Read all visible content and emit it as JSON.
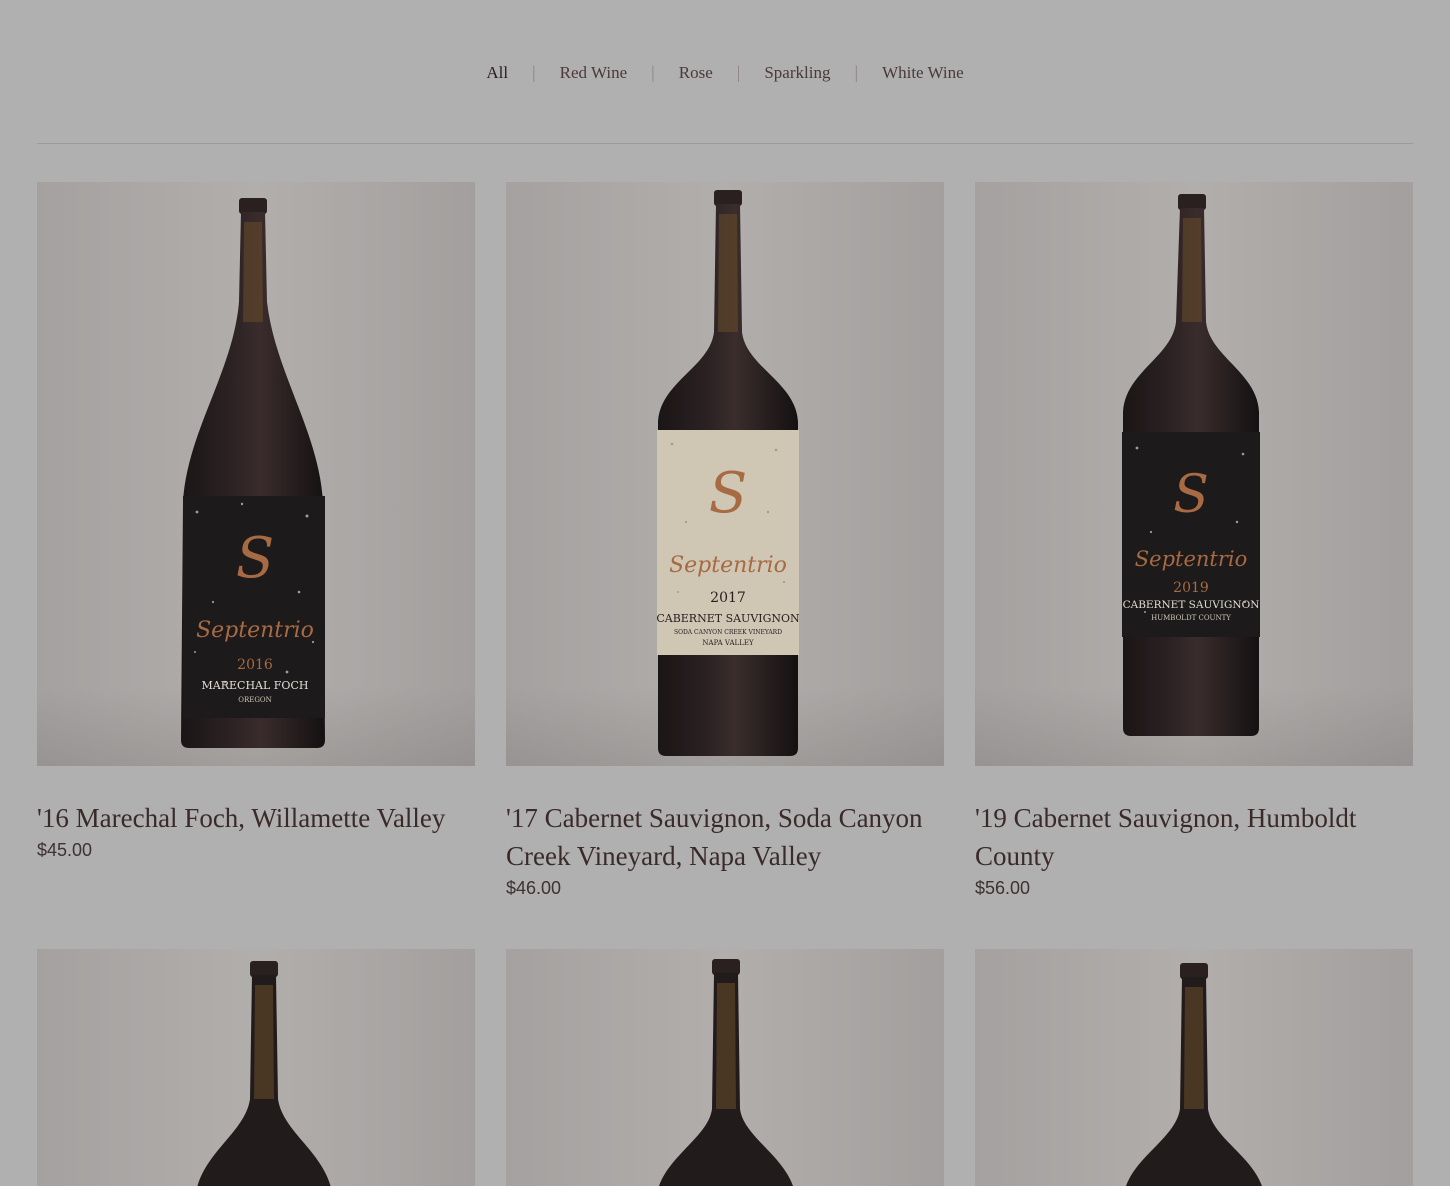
{
  "filters": [
    {
      "label": "All",
      "active": true
    },
    {
      "label": "Red Wine",
      "active": false
    },
    {
      "label": "Rose",
      "active": false
    },
    {
      "label": "Sparkling",
      "active": false
    },
    {
      "label": "White Wine",
      "active": false
    }
  ],
  "separator": "|",
  "products": [
    {
      "title": "'16 Marechal Foch, Willamette Valley",
      "price": "$45.00",
      "label": {
        "brand": "Septentrio",
        "year": "2016",
        "varietal": "MARECHAL FOCH",
        "region": "OREGON",
        "vineyard": ""
      }
    },
    {
      "title": "'17 Cabernet Sauvignon, Soda Canyon Creek Vineyard, Napa Valley",
      "price": "$46.00",
      "label": {
        "brand": "Septentrio",
        "year": "2017",
        "varietal": "CABERNET SAUVIGNON",
        "region": "NAPA VALLEY",
        "vineyard": "SODA CANYON CREEK VINEYARD"
      }
    },
    {
      "title": "'19 Cabernet Sauvignon, Humboldt County",
      "price": "$56.00",
      "label": {
        "brand": "Septentrio",
        "year": "2019",
        "varietal": "CABERNET SAUVIGNON",
        "region": "HUMBOLDT COUNTY",
        "vineyard": ""
      }
    }
  ],
  "colors": {
    "background": "#b0b0b0",
    "title_text": "#3a2a2a",
    "label_dark": "#1c1a1b",
    "label_cream": "#cfc6b4",
    "label_copper": "#a76a43"
  }
}
